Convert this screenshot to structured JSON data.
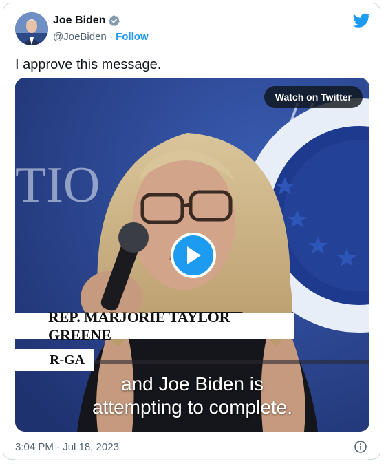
{
  "author": {
    "name": "Joe Biden",
    "handle": "@JoeBiden",
    "separator": "·",
    "follow_label": "Follow",
    "avatar_icon": "avatar-photo",
    "verified_icon": "verified-badge-icon"
  },
  "tweet": {
    "text": "I approve this message."
  },
  "media": {
    "watch_label": "Watch on Twitter",
    "play_icon": "play-icon",
    "lower_third_name": "REP. MARJORIE TAYLOR GREENE",
    "lower_third_party": "R-GA",
    "caption_line1": "and Joe Biden is",
    "caption_line2": "attempting to complete.",
    "background_text": "TIO"
  },
  "footer": {
    "timestamp": "3:04 PM · Jul 18, 2023",
    "info_icon": "info-icon"
  },
  "colors": {
    "accent": "#1d9bf0",
    "text_primary": "#0f1419",
    "text_secondary": "#536471",
    "border": "#cfd9de",
    "play_button": "#1d9bf0"
  }
}
